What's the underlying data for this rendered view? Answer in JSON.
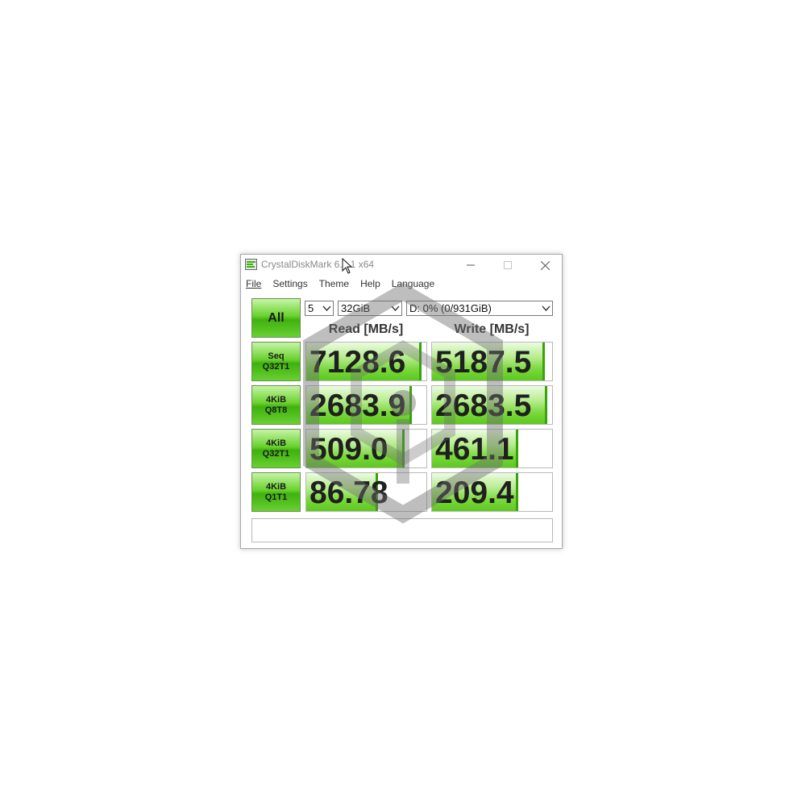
{
  "window": {
    "title": "CrystalDiskMark 6.0.1 x64"
  },
  "menu": {
    "items": [
      {
        "label": "File"
      },
      {
        "label": "Settings"
      },
      {
        "label": "Theme"
      },
      {
        "label": "Help"
      },
      {
        "label": "Language"
      }
    ]
  },
  "controls": {
    "all_label": "All",
    "count_value": "5",
    "size_value": "32GiB",
    "drive_value": "D: 0% (0/931GiB)"
  },
  "headers": {
    "read": "Read [MB/s]",
    "write": "Write [MB/s]"
  },
  "tests": [
    {
      "line1": "Seq",
      "line2": "Q32T1",
      "read": "7128.6",
      "write": "5187.5",
      "read_fill": 0.96,
      "write_fill": 0.94
    },
    {
      "line1": "4KiB",
      "line2": "Q8T8",
      "read": "2683.9",
      "write": "2683.5",
      "read_fill": 0.88,
      "write_fill": 0.96
    },
    {
      "line1": "4KiB",
      "line2": "Q32T1",
      "read": "509.0",
      "write": "461.1",
      "read_fill": 0.82,
      "write_fill": 0.72
    },
    {
      "line1": "4KiB",
      "line2": "Q1T1",
      "read": "86.78",
      "write": "209.4",
      "read_fill": 0.6,
      "write_fill": 0.72
    }
  ],
  "comment": "",
  "colors": {
    "accent_green": "#5cc81e",
    "bar_edge": "#39a30a"
  },
  "icons": {
    "app": "crystaldiskmark-icon",
    "minimize": "minimize-icon",
    "maximize": "maximize-icon",
    "close": "close-icon",
    "dropdown": "chevron-down-icon",
    "watermark": "hexagon-watermark-icon",
    "cursor": "mouse-pointer-icon"
  }
}
